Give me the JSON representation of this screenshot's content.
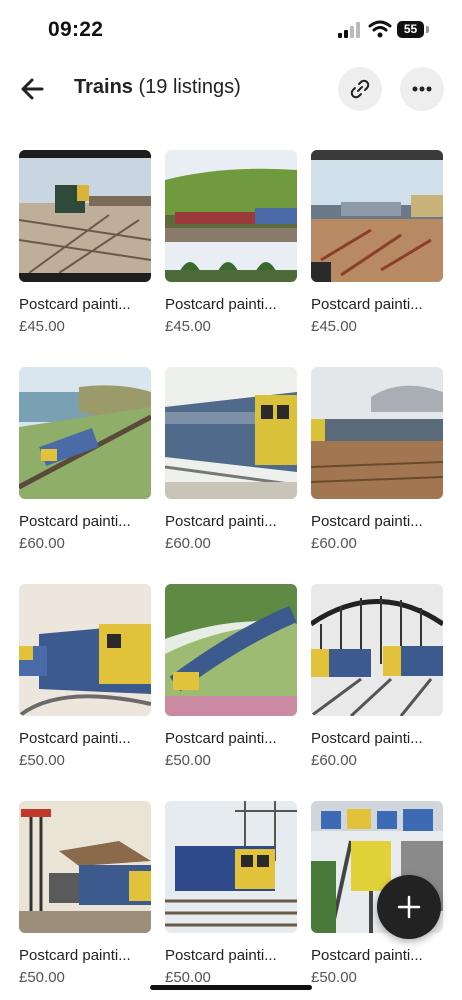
{
  "status": {
    "time": "09:22",
    "battery": "55"
  },
  "header": {
    "title": "Trains",
    "count": "(19 listings)"
  },
  "icons": {
    "back": "arrow-left-icon",
    "link": "link-icon",
    "more": "more-horizontal-icon",
    "add": "plus-icon"
  },
  "listings": [
    {
      "title": "Postcard painti...",
      "price": "£45.00"
    },
    {
      "title": "Postcard painti...",
      "price": "£45.00"
    },
    {
      "title": "Postcard painti...",
      "price": "£45.00"
    },
    {
      "title": "Postcard painti...",
      "price": "£60.00"
    },
    {
      "title": "Postcard painti...",
      "price": "£60.00"
    },
    {
      "title": "Postcard painti...",
      "price": "£60.00"
    },
    {
      "title": "Postcard painti...",
      "price": "£50.00"
    },
    {
      "title": "Postcard painti...",
      "price": "£50.00"
    },
    {
      "title": "Postcard painti...",
      "price": "£60.00"
    },
    {
      "title": "Postcard painti...",
      "price": "£50.00"
    },
    {
      "title": "Postcard painti...",
      "price": "£50.00"
    },
    {
      "title": "Postcard painti...",
      "price": "£50.00"
    }
  ]
}
